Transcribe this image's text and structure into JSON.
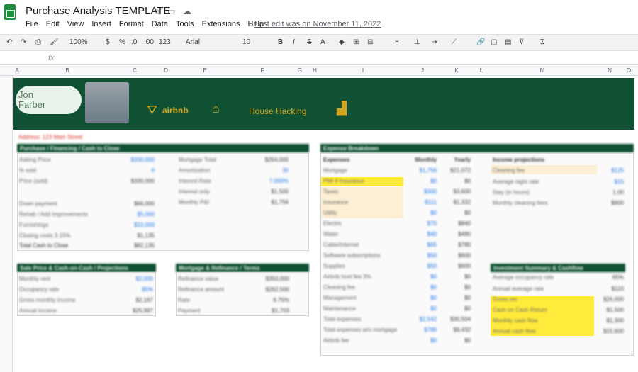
{
  "app": {
    "title": "Purchase Analysis TEMPLATE",
    "last_edit": "Last edit was on November 11, 2022"
  },
  "menu": [
    "File",
    "Edit",
    "View",
    "Insert",
    "Format",
    "Data",
    "Tools",
    "Extensions",
    "Help"
  ],
  "toolbar": {
    "zoom": "100%",
    "currency": "$",
    "percent": "%",
    "dec_less": ".0",
    "dec_more": ".00",
    "format": "123",
    "font": "Arial",
    "size": "10"
  },
  "columns": [
    "A",
    "B",
    "C",
    "D",
    "E",
    "F",
    "G",
    "H",
    "I",
    "J",
    "K",
    "L",
    "M",
    "N",
    "O"
  ],
  "banner": {
    "name_line1": "Jon",
    "name_line2": "Farber",
    "brand": "airbnb",
    "tagline": "House Hacking"
  },
  "address": "Address: 123 Main Street",
  "sections": {
    "purchase": "Purchase / Financing / Cash to Close",
    "expense": "Expense Breakdown",
    "left_small": "Sale Price & Cash-on-Cash / Projections",
    "mid_small": "Mortgage & Refinance / Terms",
    "right_small": "Investment Summary & Cashflow"
  },
  "purchase_rows": [
    {
      "label": "Asking Price",
      "value": "$330,000",
      "blue": true
    },
    {
      "label": "% sold",
      "value": "0",
      "blue": true
    },
    {
      "label": "Price (sold)",
      "value": "$330,000",
      "blue": false
    },
    {
      "label": "Down payment",
      "value": "$66,000",
      "blue": false
    },
    {
      "label": "Rehab / Add Improvements",
      "value": "$5,000",
      "blue": true
    },
    {
      "label": "Furnishings",
      "value": "$10,000",
      "blue": true
    },
    {
      "label": "Closing costs 3.15%",
      "value": "$1,135",
      "blue": false
    },
    {
      "label": "Total Cash to Close",
      "value": "$82,135",
      "blue": false
    }
  ],
  "mortgage_rows": [
    {
      "label": "Mortgage Total",
      "value": "$264,000"
    },
    {
      "label": "Amortization",
      "value": "30"
    },
    {
      "label": "Interest Rate",
      "value": "7.000%"
    },
    {
      "label": "Interest only",
      "value": "$1,500"
    },
    {
      "label": "Monthly P&I",
      "value": "$1,756"
    }
  ],
  "expense_headers": [
    "Expenses",
    "Monthly",
    "Yearly"
  ],
  "expense_rows": [
    {
      "label": "Mortgage",
      "m": "$1,756",
      "y": "$21,072",
      "hl": "none"
    },
    {
      "label": "PMI if Insurance",
      "m": "$0",
      "y": "$0",
      "hl": "yellow"
    },
    {
      "label": "Taxes",
      "m": "$300",
      "y": "$3,600",
      "hl": "cream"
    },
    {
      "label": "Insurance",
      "m": "$111",
      "y": "$1,332",
      "hl": "cream"
    },
    {
      "label": "Utility",
      "m": "$0",
      "y": "$0",
      "hl": "cream"
    },
    {
      "label": "Electric",
      "m": "$70",
      "y": "$840",
      "hl": "none"
    },
    {
      "label": "Water",
      "m": "$40",
      "y": "$480",
      "hl": "none"
    },
    {
      "label": "Cable/Internet",
      "m": "$65",
      "y": "$780",
      "hl": "none"
    },
    {
      "label": "Software subscriptions",
      "m": "$50",
      "y": "$600",
      "hl": "none"
    },
    {
      "label": "Supplies",
      "m": "$50",
      "y": "$600",
      "hl": "none"
    },
    {
      "label": "Airbnb host fee 3%",
      "m": "$0",
      "y": "$0",
      "hl": "none"
    },
    {
      "label": "Cleaning fee",
      "m": "$0",
      "y": "$0",
      "hl": "none"
    },
    {
      "label": "Management",
      "m": "$0",
      "y": "$0",
      "hl": "none"
    },
    {
      "label": "Maintenance",
      "m": "$0",
      "y": "$0",
      "hl": "none"
    },
    {
      "label": "Total expenses",
      "m": "$2,542",
      "y": "$30,504",
      "hl": "none"
    },
    {
      "label": "Total expenses w/o mortgage",
      "m": "$786",
      "y": "$9,432",
      "hl": "none"
    },
    {
      "label": "Airbnb fee",
      "m": "$0",
      "y": "$0",
      "hl": "none"
    }
  ],
  "income_header": "Income projections",
  "income_rows": [
    {
      "label": "Cleaning fee",
      "value": "$125",
      "hl": "cream"
    },
    {
      "label": "Average night rate",
      "value": "$15",
      "hl": "none"
    },
    {
      "label": "Stay (in hours)",
      "value": "1.00",
      "hl": "none"
    },
    {
      "label": "Monthly cleaning fees",
      "value": "$900",
      "hl": "none"
    }
  ],
  "summary_rows": [
    {
      "label": "Average occupancy rate",
      "value": "65%"
    },
    {
      "label": "Annual average rate",
      "value": "$110"
    },
    {
      "label": "Gross rev",
      "value": "$26,000"
    },
    {
      "label": "Cash on Cash Return",
      "value": "$1,500"
    },
    {
      "label": "Monthly cash flow",
      "value": "$1,300"
    },
    {
      "label": "Annual cash flow",
      "value": "$15,600"
    }
  ],
  "left_small_rows": [
    {
      "label": "Monthly rent",
      "value": "$2,000"
    },
    {
      "label": "Occupancy rate",
      "value": "85%"
    },
    {
      "label": "Gross monthly income",
      "value": "$2,167"
    },
    {
      "label": "Annual income",
      "value": "$25,997"
    }
  ],
  "mid_small_rows": [
    {
      "label": "Refinance value",
      "value": "$350,000"
    },
    {
      "label": "Refinance amount",
      "value": "$262,500"
    },
    {
      "label": "Rate",
      "value": "6.75%"
    },
    {
      "label": "Payment",
      "value": "$1,703"
    }
  ],
  "colors": {
    "banner": "#0f5132",
    "gold": "#d3a624",
    "highlight": "#ffeb3b",
    "cream": "#fcefd4"
  }
}
